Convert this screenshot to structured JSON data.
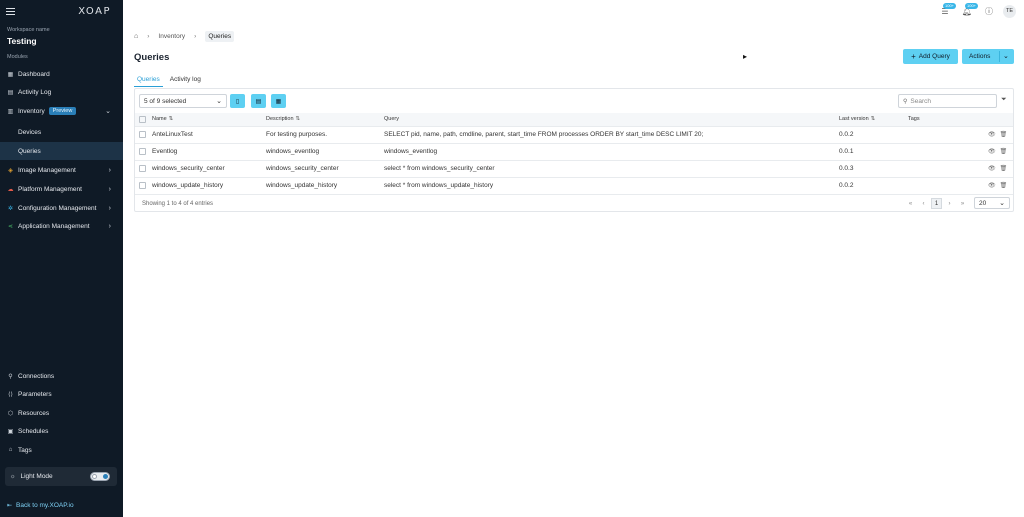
{
  "sidebar": {
    "logo": "XOAP",
    "workspace_label": "Workspace name",
    "workspace_name": "Testing",
    "modules_label": "Modules",
    "items": [
      {
        "label": "Dashboard",
        "icon": "dashboard-icon"
      },
      {
        "label": "Activity Log",
        "icon": "activity-icon"
      },
      {
        "label": "Inventory",
        "icon": "inventory-icon",
        "badge": "Preview"
      },
      {
        "label": "Devices"
      },
      {
        "label": "Queries"
      },
      {
        "label": "Image Management",
        "icon": "image-icon"
      },
      {
        "label": "Platform Management",
        "icon": "cloud-icon"
      },
      {
        "label": "Configuration Management",
        "icon": "config-icon"
      },
      {
        "label": "Application Management",
        "icon": "app-icon"
      }
    ],
    "bottom_items": [
      {
        "label": "Connections",
        "icon": "connections-icon"
      },
      {
        "label": "Parameters",
        "icon": "parameters-icon"
      },
      {
        "label": "Resources",
        "icon": "resources-icon"
      },
      {
        "label": "Schedules",
        "icon": "schedules-icon"
      },
      {
        "label": "Tags",
        "icon": "tags-icon"
      }
    ],
    "light_mode_label": "Light Mode",
    "back_link": "Back to my.XOAP.io"
  },
  "topbar": {
    "tasks_badge": "100+",
    "notifications_badge": "100+",
    "avatar_initials": "TE"
  },
  "breadcrumb": {
    "items": [
      "Inventory",
      "Queries"
    ]
  },
  "page": {
    "title": "Queries",
    "add_button": "Add Query",
    "actions_button": "Actions"
  },
  "tabs": [
    "Queries",
    "Activity log"
  ],
  "toolbar": {
    "columns_selected": "5 of 9 selected",
    "search_placeholder": "Search"
  },
  "table": {
    "headers": [
      "Name",
      "Description",
      "Query",
      "Last version",
      "Tags"
    ],
    "rows": [
      {
        "name": "AnteLinuxTest",
        "description": "For testing purposes.",
        "query": "SELECT pid, name, path, cmdline, parent, start_time FROM processes ORDER BY start_time DESC LIMIT 20;",
        "version": "0.0.2",
        "tags": ""
      },
      {
        "name": "Eventlog",
        "description": "windows_eventlog",
        "query": "windows_eventlog",
        "version": "0.0.1",
        "tags": ""
      },
      {
        "name": "windows_security_center",
        "description": "windows_security_center",
        "query": "select * from windows_security_center",
        "version": "0.0.3",
        "tags": ""
      },
      {
        "name": "windows_update_history",
        "description": "windows_update_history",
        "query": "select * from windows_update_history",
        "version": "0.0.2",
        "tags": ""
      }
    ]
  },
  "footer": {
    "showing": "Showing 1 to 4 of 4 entries",
    "current_page": "1",
    "page_size": "20"
  },
  "colors": {
    "sidebar_bg": "#0f1a26",
    "accent": "#5ed0f2",
    "link": "#2a9fd6"
  }
}
